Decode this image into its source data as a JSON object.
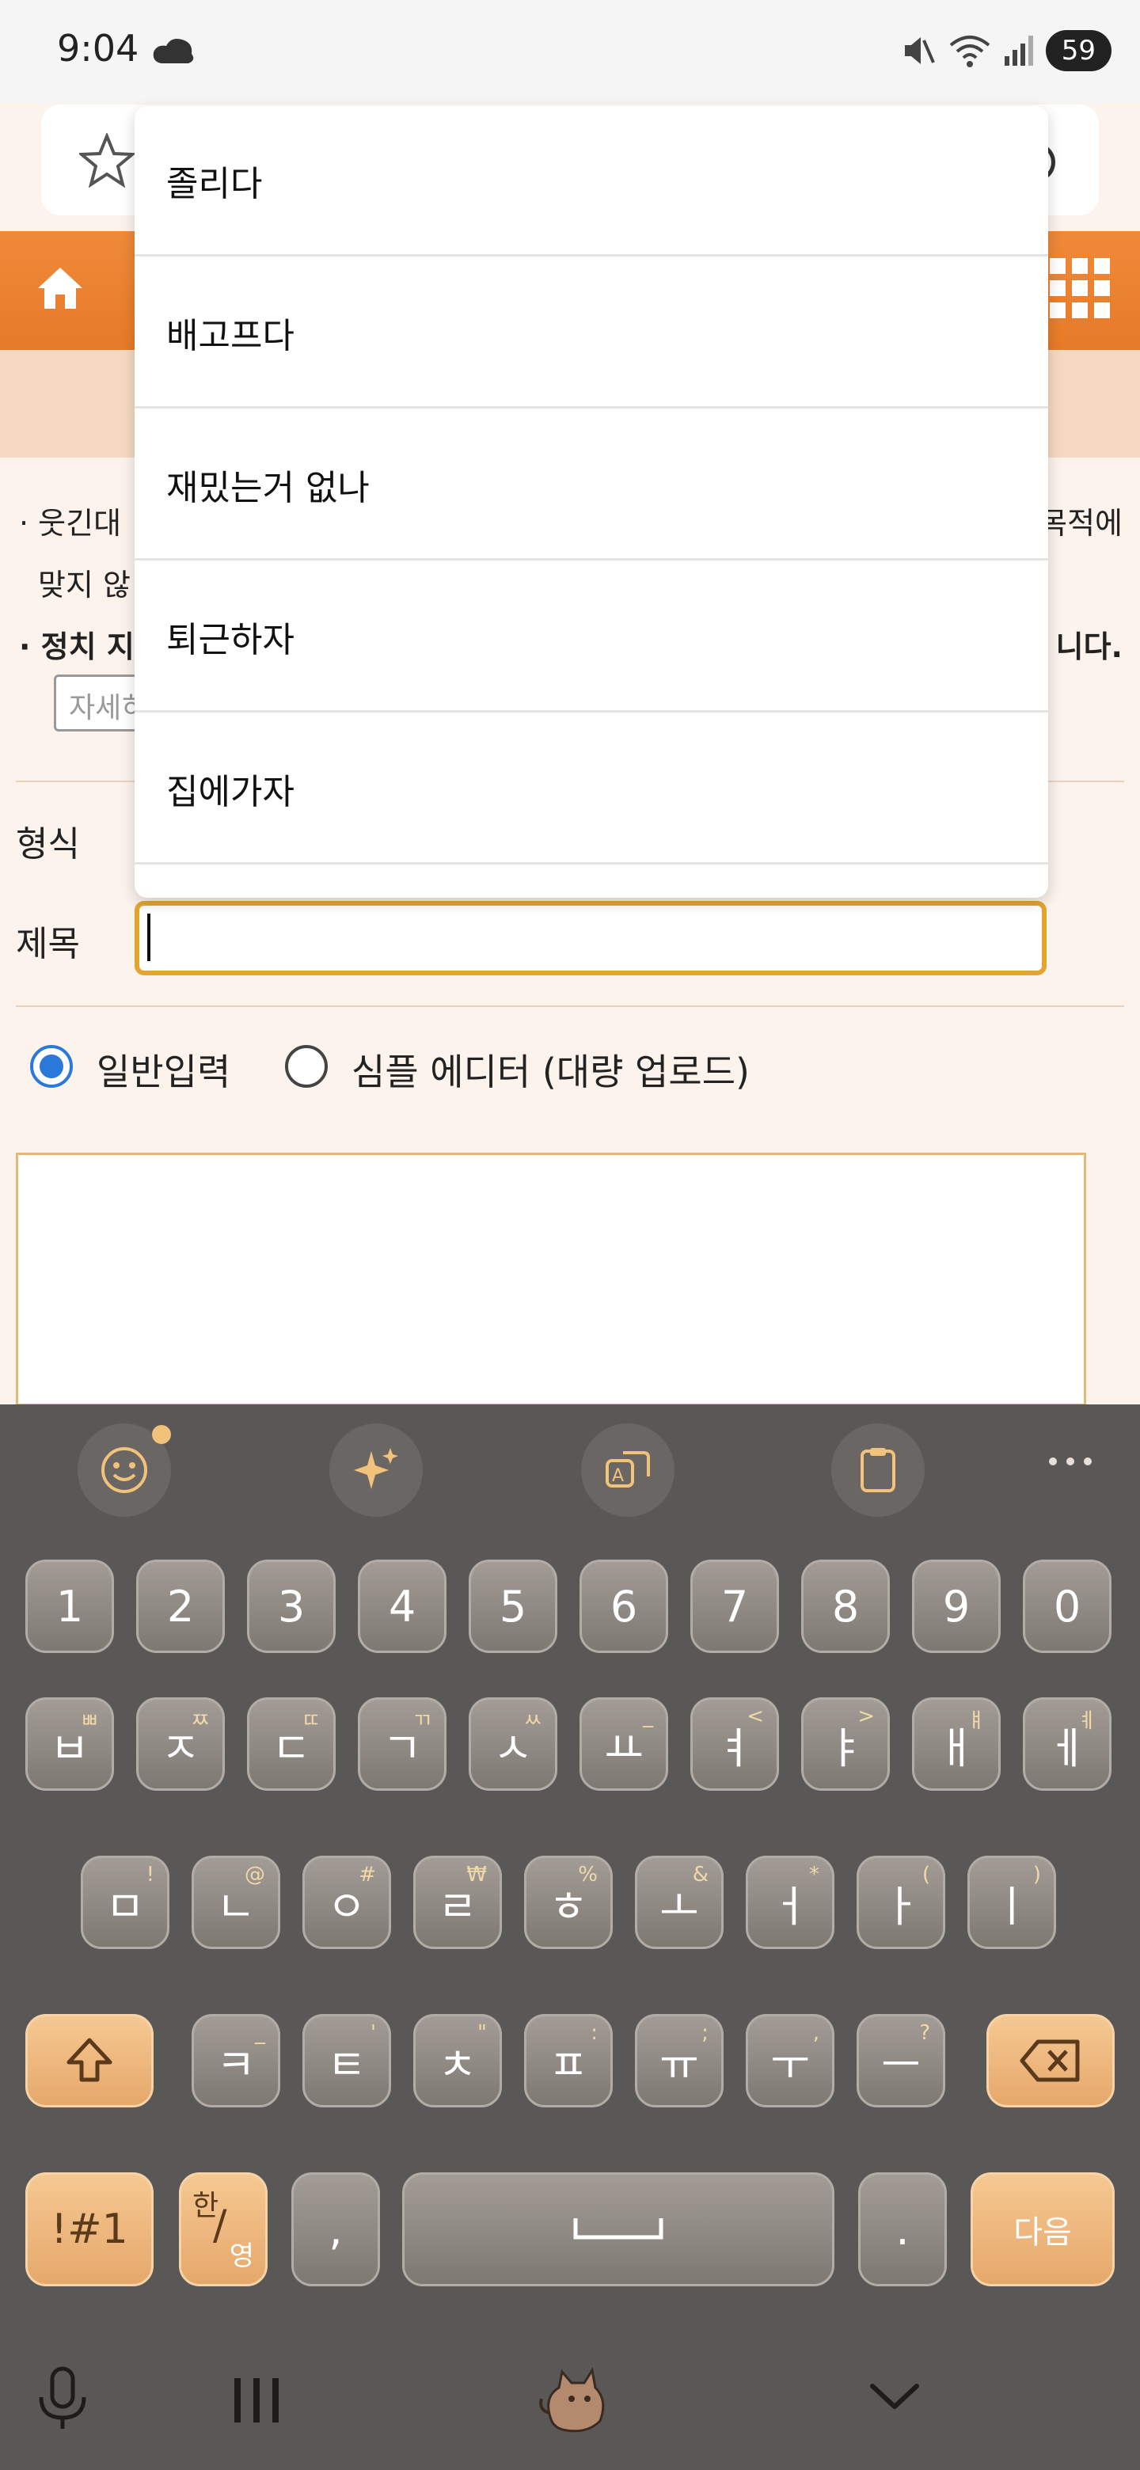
{
  "status_bar": {
    "time": "9:04",
    "battery": "59"
  },
  "notices": {
    "line1_start": "· 웃긴대",
    "line1_end": "목적에",
    "line2": "맞지 않",
    "line3_start": "· 정치 지",
    "line3_end": "니다.",
    "detail_button": "자세히"
  },
  "form": {
    "format_label": "형식",
    "title_label": "제목",
    "title_value": ""
  },
  "radios": {
    "normal": "일반입력",
    "simple": "심플 에디터 (대량 업로드)"
  },
  "autocomplete": {
    "items": [
      "졸리다",
      "배고프다",
      "재밌는거 없나",
      "퇴근하자",
      "집에가자"
    ]
  },
  "keyboard": {
    "row_numbers": [
      "1",
      "2",
      "3",
      "4",
      "5",
      "6",
      "7",
      "8",
      "9",
      "0"
    ],
    "row1": [
      {
        "main": "ㅂ",
        "sub": "ㅃ"
      },
      {
        "main": "ㅈ",
        "sub": "ㅉ"
      },
      {
        "main": "ㄷ",
        "sub": "ㄸ"
      },
      {
        "main": "ㄱ",
        "sub": "ㄲ"
      },
      {
        "main": "ㅅ",
        "sub": "ㅆ"
      },
      {
        "main": "ㅛ",
        "sub": "_"
      },
      {
        "main": "ㅕ",
        "sub": "<"
      },
      {
        "main": "ㅑ",
        "sub": ">"
      },
      {
        "main": "ㅐ",
        "sub": "ㅒ"
      },
      {
        "main": "ㅔ",
        "sub": "ㅖ"
      }
    ],
    "row2": [
      {
        "main": "ㅁ",
        "sub": "!"
      },
      {
        "main": "ㄴ",
        "sub": "@"
      },
      {
        "main": "ㅇ",
        "sub": "#"
      },
      {
        "main": "ㄹ",
        "sub": "₩"
      },
      {
        "main": "ㅎ",
        "sub": "%"
      },
      {
        "main": "ㅗ",
        "sub": "&"
      },
      {
        "main": "ㅓ",
        "sub": "*"
      },
      {
        "main": "ㅏ",
        "sub": "("
      },
      {
        "main": "ㅣ",
        "sub": ")"
      }
    ],
    "row3": [
      {
        "main": "ㅋ",
        "sub": "_"
      },
      {
        "main": "ㅌ",
        "sub": "'"
      },
      {
        "main": "ㅊ",
        "sub": "\""
      },
      {
        "main": "ㅍ",
        "sub": ":"
      },
      {
        "main": "ㅠ",
        "sub": ";"
      },
      {
        "main": "ㅜ",
        "sub": ","
      },
      {
        "main": "ㅡ",
        "sub": "?"
      }
    ],
    "symbols_key": "!#1",
    "lang_key_top": "한",
    "lang_key_bottom": "영",
    "comma_key": ",",
    "period_key": ".",
    "next_key": "다음"
  }
}
